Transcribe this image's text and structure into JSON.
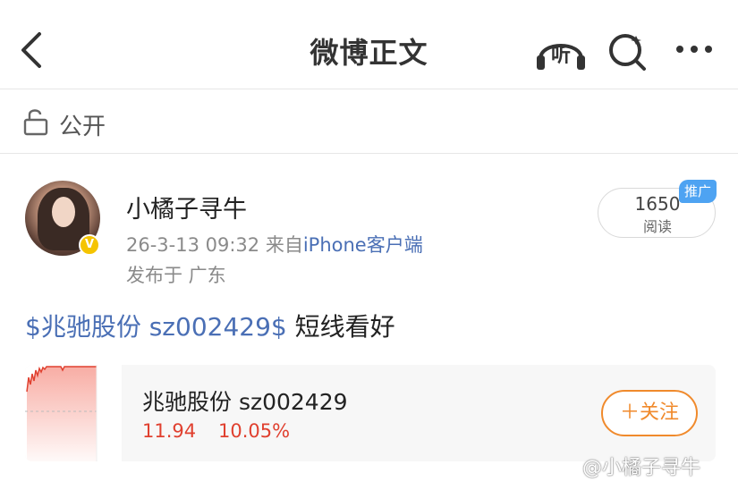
{
  "header": {
    "title": "微博正文",
    "listen_label": "听"
  },
  "visibility": {
    "label": "公开"
  },
  "author": {
    "name": "小橘子寻牛",
    "time": "26-3-13 09:32",
    "source_prefix": "来自",
    "source": "iPhone客户端",
    "location": "发布于 广东"
  },
  "reads": {
    "count": "1650",
    "label": "阅读",
    "promo_badge": "推广"
  },
  "post": {
    "tag": "$兆驰股份 sz002429$",
    "text": " 短线看好"
  },
  "stock_card": {
    "name": "兆驰股份 sz002429",
    "price": "11.94",
    "change": "10.05%",
    "follow_label": "＋关注"
  },
  "watermark": "@小橘子寻牛",
  "colors": {
    "link": "#4a6fb5",
    "rise": "#e0402f",
    "follow": "#f08a2c",
    "promo": "#4ea3f2",
    "verified": "#f5c400"
  }
}
